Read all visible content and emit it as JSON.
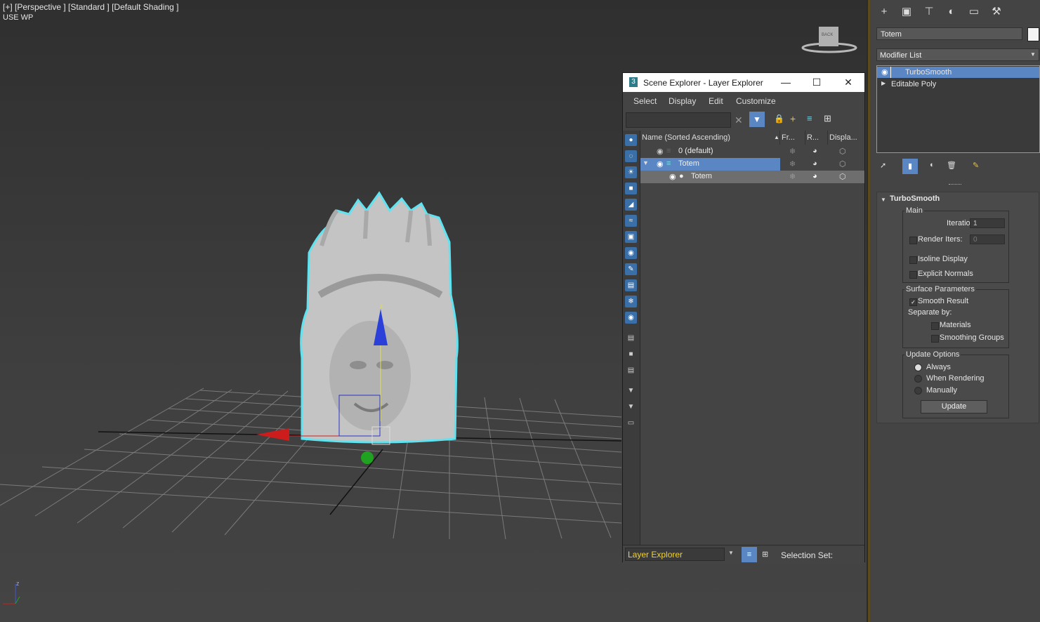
{
  "viewport": {
    "label": "[+] [Perspective ] [Standard ] [Default Shading ]",
    "use_wp": "USE WP",
    "viewcube_face": "BACK",
    "gizmo_axis": "z",
    "corner_axis_z": "z"
  },
  "explorer": {
    "title": "Scene Explorer - Layer Explorer",
    "menu": [
      "Select",
      "Display",
      "Edit",
      "Customize"
    ],
    "columns": [
      "Name (Sorted Ascending)",
      "Fr...",
      "R...",
      "Displa..."
    ],
    "rows": [
      {
        "name": "0 (default)",
        "level": 0
      },
      {
        "name": "Totem",
        "level": 0,
        "selected": true
      },
      {
        "name": "Totem",
        "level": 1,
        "highlight": true
      }
    ],
    "bottom_dropdown": "Layer Explorer",
    "selection_set_label": "Selection Set:"
  },
  "command_panel": {
    "object_name": "Totem",
    "modifier_list": "Modifier List",
    "stack": [
      "TurboSmooth",
      "Editable Poly"
    ],
    "rollout": {
      "title": "TurboSmooth",
      "main": "Main",
      "iterations_label": "Iterations:",
      "iterations_value": "1",
      "render_iters_label": "Render Iters:",
      "render_iters_value": "0",
      "isoline": "Isoline Display",
      "explicit_normals": "Explicit Normals",
      "surface_params": "Surface Parameters",
      "smooth_result": "Smooth Result",
      "separate_by": "Separate by:",
      "materials": "Materials",
      "smoothing_groups": "Smoothing Groups",
      "update_options": "Update Options",
      "always": "Always",
      "when_rendering": "When Rendering",
      "manually": "Manually",
      "update_button": "Update"
    }
  },
  "colors": {
    "selection_blue": "#5b86c4",
    "layer_dropdown_text": "#f0d238",
    "selection_outline": "#5fe3f0"
  }
}
